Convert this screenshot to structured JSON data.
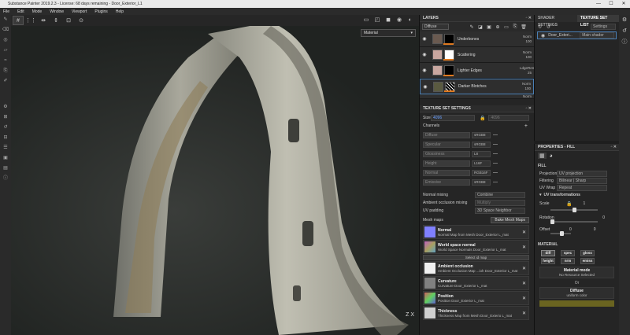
{
  "titlebar": {
    "title": "Substance Painter 2019.2.3 - License: 68 days remaining - Door_Exterior_L1",
    "minimize": "—",
    "maximize": "☐",
    "close": "✕"
  },
  "menu": [
    "File",
    "Edit",
    "Mode",
    "Window",
    "Viewport",
    "Plugins",
    "Help"
  ],
  "viewport": {
    "material_mode": "Material",
    "axis_label": "Z  X"
  },
  "layers_panel": {
    "title": "LAYERS",
    "channel": "Diffuse",
    "layers": [
      {
        "name": "Underbones",
        "blend": "Norm",
        "opacity": "100",
        "thumb_color": "#6a5a50"
      },
      {
        "name": "Scattering",
        "blend": "Norm",
        "opacity": "100",
        "thumb_color": "#c9a7a0"
      },
      {
        "name": "Lighter Edges",
        "blend": "LdgeRem",
        "opacity": "25",
        "thumb_color": "#c9a7a0"
      },
      {
        "name": "Darker Blotches",
        "blend": "Norm",
        "opacity": "100",
        "thumb_color": "#5a5a40"
      }
    ],
    "last_blend": "Norm"
  },
  "texture_set_settings": {
    "title": "TEXTURE SET SETTINGS",
    "size_label": "Size",
    "size_value": "4096",
    "size_value2": "4096",
    "channels_label": "Channels",
    "channels": [
      {
        "name": "Diffuse",
        "format": "sRGB8"
      },
      {
        "name": "Specular",
        "format": "sRGB8"
      },
      {
        "name": "Glossiness",
        "format": "L8"
      },
      {
        "name": "Height",
        "format": "L16F"
      },
      {
        "name": "Normal",
        "format": "RGB16F"
      },
      {
        "name": "Emissive",
        "format": "sRGB8"
      }
    ],
    "normal_mixing_label": "Normal mixing",
    "normal_mixing": "Combine",
    "ao_mixing_label": "Ambient occlusion mixing",
    "ao_mixing": "Multiply",
    "uv_padding_label": "UV padding",
    "uv_padding": "3D Space Neighbor",
    "mesh_maps_label": "Mesh maps",
    "bake_button": "Bake Mesh Maps",
    "mesh_maps": [
      {
        "name": "Normal",
        "source": "Normal Map from Mesh Door_Exterior L_mat",
        "color": "#8080ff"
      },
      {
        "name": "World space normal",
        "source": "World Space Normals Door_Exterior L_mat",
        "color": "#a8a060"
      },
      {
        "name": "Ambient occlusion",
        "source": "Ambient Occlusion Map ...ioh Door_Exterior L_mat",
        "color": "#f0f0f0"
      },
      {
        "name": "Curvature",
        "source": "Curvature Door_Exterior L_mat",
        "color": "#808080"
      },
      {
        "name": "Position",
        "source": "Position Door_Exterior L_mat",
        "color": "#b08060"
      },
      {
        "name": "Thickness",
        "source": "Thickness Map from Mesh Door_Exterio L_mat",
        "color": "#d0d0d0"
      }
    ],
    "select_map": "Select id map"
  },
  "shader_panel": {
    "tab1": "SHADER SETTINGS",
    "tab2": "TEXTURE SET LIST",
    "settings_btn": "Settings",
    "item_name": "Door_Exteri...",
    "item_shader": "Main shader"
  },
  "properties_panel": {
    "title": "PROPERTIES - FILL",
    "fill_label": "FILL",
    "projection_label": "Projection",
    "projection": "UV projection",
    "filtering_label": "Filtering",
    "filtering": "Bilinear | Sharp",
    "uv_wrap_label": "UV Wrap",
    "uv_wrap": "Repeat",
    "uv_transform_label": "UV transformations",
    "scale_label": "Scale",
    "scale_value": "1",
    "rotation_label": "Rotation",
    "rotation_value": "0",
    "offset_label": "Offset",
    "offset_x": "0",
    "offset_y": "0",
    "material_label": "MATERIAL",
    "mat_buttons": [
      "diff",
      "spec",
      "gloss",
      "height",
      "nrm",
      "emiss"
    ],
    "material_mode_label": "Material mode",
    "material_mode_value": "No Resource Selected",
    "or_label": "Or",
    "diffuse_label": "Diffuse",
    "diffuse_value": "uniform color",
    "diffuse_color": "#6a6420"
  }
}
